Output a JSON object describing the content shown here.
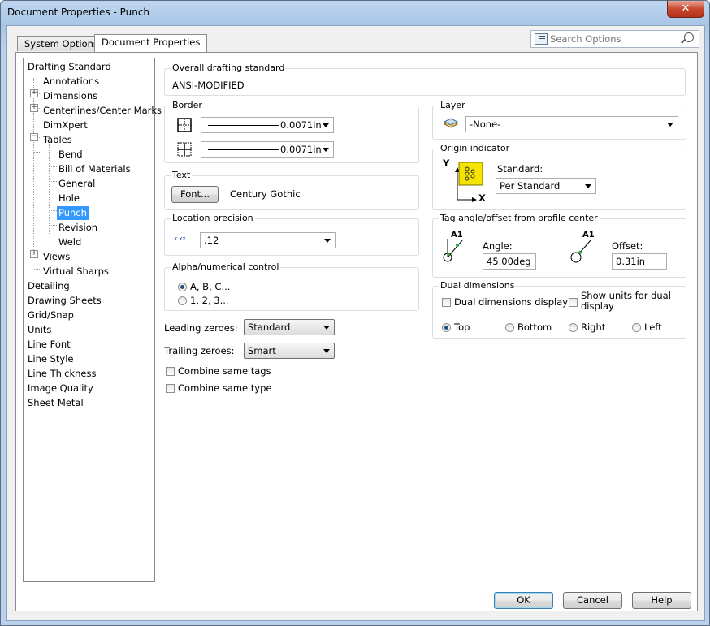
{
  "window": {
    "title": "Document Properties - Punch",
    "close_glyph": "✕"
  },
  "tabs": [
    {
      "label": "System Options"
    },
    {
      "label": "Document Properties"
    }
  ],
  "search": {
    "placeholder": "Search Options"
  },
  "tree": {
    "items": [
      {
        "label": "Drafting Standard"
      },
      {
        "label": "Annotations"
      },
      {
        "label": "Dimensions"
      },
      {
        "label": "Centerlines/Center Marks"
      },
      {
        "label": "DimXpert"
      },
      {
        "label": "Tables"
      },
      {
        "label": "Bend"
      },
      {
        "label": "Bill of Materials"
      },
      {
        "label": "General"
      },
      {
        "label": "Hole"
      },
      {
        "label": "Punch"
      },
      {
        "label": "Revision"
      },
      {
        "label": "Weld"
      },
      {
        "label": "Views"
      },
      {
        "label": "Virtual Sharps"
      },
      {
        "label": "Detailing"
      },
      {
        "label": "Drawing Sheets"
      },
      {
        "label": "Grid/Snap"
      },
      {
        "label": "Units"
      },
      {
        "label": "Line Font"
      },
      {
        "label": "Line Style"
      },
      {
        "label": "Line Thickness"
      },
      {
        "label": "Image Quality"
      },
      {
        "label": "Sheet Metal"
      }
    ],
    "selected": "Punch",
    "expand_glyph": "+",
    "collapse_glyph": "−"
  },
  "overall": {
    "label": "Overall drafting standard",
    "value": "ANSI-MODIFIED"
  },
  "border": {
    "label": "Border",
    "thickness1": "0.0071in",
    "thickness2": "0.0071in"
  },
  "layer": {
    "label": "Layer",
    "value": "-None-"
  },
  "text": {
    "label": "Text",
    "font_button": "Font...",
    "font_name": "Century Gothic"
  },
  "origin": {
    "label": "Origin indicator",
    "standard_label": "Standard:",
    "standard_value": "Per Standard",
    "axis_y": "Y",
    "axis_x": "X"
  },
  "location": {
    "label": "Location precision",
    "value": ".12",
    "icon_text": "x.xx"
  },
  "tag_angle": {
    "label": "Tag angle/offset from profile center",
    "angle_label": "Angle:",
    "angle_value": "45.00deg",
    "offset_label": "Offset:",
    "offset_value": "0.31in",
    "icon_text": "A1"
  },
  "alpha": {
    "label": "Alpha/numerical control",
    "option1": "A, B, C...",
    "option2": "1, 2, 3..."
  },
  "dual": {
    "label": "Dual dimensions",
    "display_label": "Dual dimensions display",
    "show_units_label": "Show units for dual display",
    "top": "Top",
    "bottom": "Bottom",
    "right": "Right",
    "left": "Left"
  },
  "zeroes": {
    "leading_label": "Leading zeroes:",
    "leading_value": "Standard",
    "trailing_label": "Trailing zeroes:",
    "trailing_value": "Smart"
  },
  "combine": {
    "tags_label": "Combine same tags",
    "type_label": "Combine same type"
  },
  "buttons": {
    "ok": "OK",
    "cancel": "Cancel",
    "help": "Help"
  },
  "colors": {
    "selection": "#3399ff",
    "origin_icon_bg": "#f5e400",
    "close_red": "#c8472e"
  }
}
